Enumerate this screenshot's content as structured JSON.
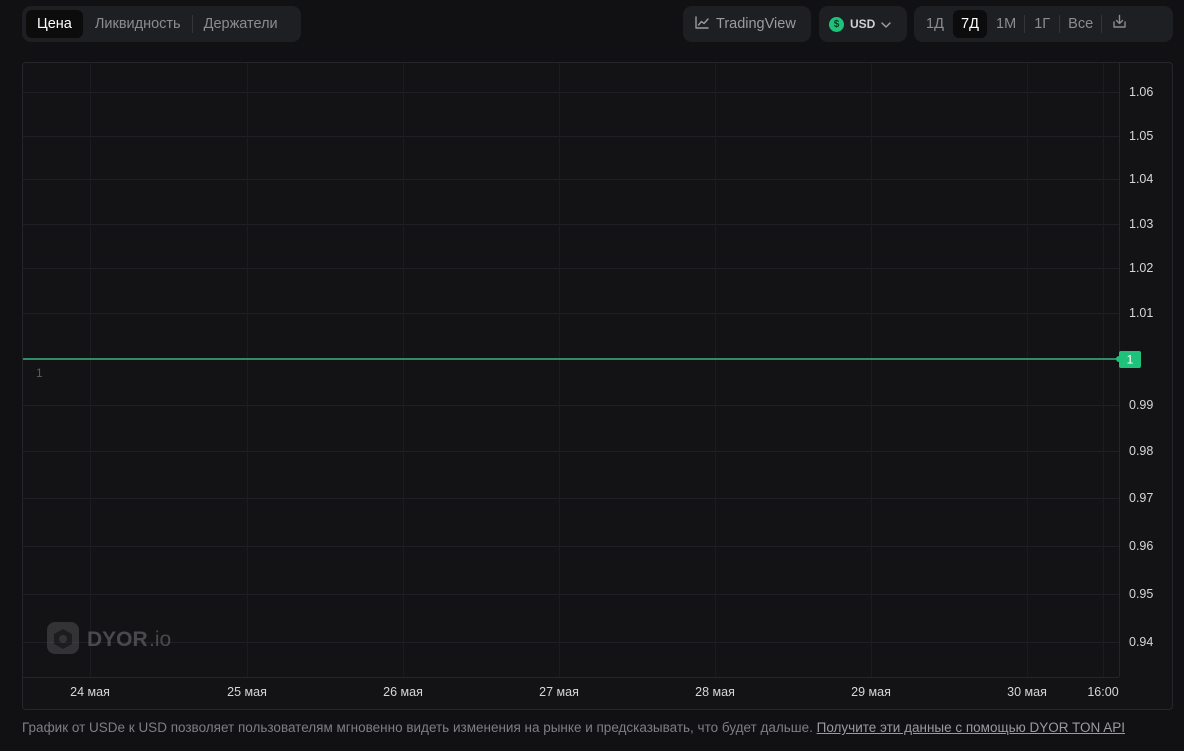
{
  "tabs": [
    {
      "label": "Цена",
      "active": true
    },
    {
      "label": "Ликвидность",
      "active": false
    },
    {
      "label": "Держатели",
      "active": false
    }
  ],
  "tradingview": {
    "label": "TradingView",
    "icon": "line-chart-icon"
  },
  "currency": {
    "label": "USD",
    "icon_glyph": "$",
    "icon": "dollar-coin-icon"
  },
  "ranges": [
    {
      "label": "1Д",
      "active": false
    },
    {
      "label": "7Д",
      "active": true
    },
    {
      "label": "1М",
      "active": false
    },
    {
      "label": "1Г",
      "active": false
    },
    {
      "label": "Все",
      "active": false
    }
  ],
  "download": {
    "icon": "download-icon"
  },
  "watermark": {
    "brand": "DYOR",
    "suffix": ".io"
  },
  "chart_data": {
    "type": "line",
    "series": [
      {
        "values": [
          1,
          1
        ]
      }
    ],
    "x": [
      "24 мая",
      "25 мая",
      "26 мая",
      "27 мая",
      "28 мая",
      "29 мая",
      "30 мая",
      "16:00"
    ],
    "x_ticks": [
      "24 мая",
      "25 мая",
      "26 мая",
      "27 мая",
      "28 мая",
      "29 мая",
      "30 мая",
      "16:00"
    ],
    "y_ticks": [
      "1.06",
      "1.05",
      "1.04",
      "1.03",
      "1.02",
      "1.01",
      "1",
      "0.99",
      "0.98",
      "0.97",
      "0.96",
      "0.95",
      "0.94"
    ],
    "ylim": [
      0.94,
      1.06
    ],
    "y_scale": "nonuniform",
    "last_value_label": "1",
    "left_value_label": "1",
    "line_color": "#3fb27f",
    "badge_color": "#1fc27a",
    "grid": true
  },
  "footer": {
    "text": "График от USDe к USD позволяет пользователям мгновенно видеть изменения на рынке и предсказывать, что будет дальше. ",
    "link": "Получите эти данные с помощью DYOR TON API"
  }
}
